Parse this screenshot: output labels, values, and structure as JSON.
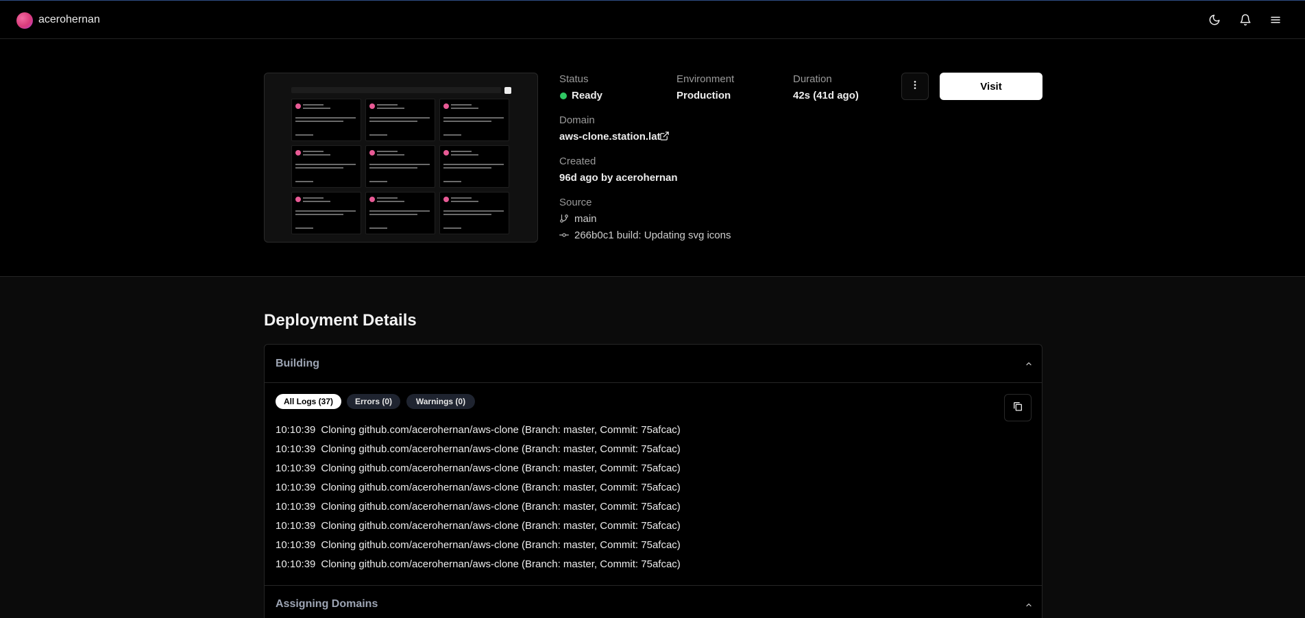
{
  "header": {
    "username": "acerohernan"
  },
  "deployment": {
    "status_label": "Status",
    "status_value": "Ready",
    "environment_label": "Environment",
    "environment_value": "Production",
    "duration_label": "Duration",
    "duration_value": "42s (41d ago)",
    "domain_label": "Domain",
    "domain_value": "aws-clone.station.lat",
    "created_label": "Created",
    "created_value": "96d ago by acerohernan",
    "source_label": "Source",
    "branch": "main",
    "commit": "266b0c1 build: Updating svg icons",
    "visit_label": "Visit"
  },
  "details": {
    "title": "Deployment Details",
    "building_title": "Building",
    "filters": [
      "All Logs (37)",
      "Errors (0)",
      "Warnings (0)"
    ],
    "logs": [
      {
        "time": "10:10:39",
        "msg": "Cloning github.com/acerohernan/aws-clone (Branch: master, Commit: 75afcac)"
      },
      {
        "time": "10:10:39",
        "msg": "Cloning github.com/acerohernan/aws-clone (Branch: master, Commit: 75afcac)"
      },
      {
        "time": "10:10:39",
        "msg": "Cloning github.com/acerohernan/aws-clone (Branch: master, Commit: 75afcac)"
      },
      {
        "time": "10:10:39",
        "msg": "Cloning github.com/acerohernan/aws-clone (Branch: master, Commit: 75afcac)"
      },
      {
        "time": "10:10:39",
        "msg": "Cloning github.com/acerohernan/aws-clone (Branch: master, Commit: 75afcac)"
      },
      {
        "time": "10:10:39",
        "msg": "Cloning github.com/acerohernan/aws-clone (Branch: master, Commit: 75afcac)"
      },
      {
        "time": "10:10:39",
        "msg": "Cloning github.com/acerohernan/aws-clone (Branch: master, Commit: 75afcac)"
      },
      {
        "time": "10:10:39",
        "msg": "Cloning github.com/acerohernan/aws-clone (Branch: master, Commit: 75afcac)"
      }
    ],
    "assigning_title": "Assigning Domains"
  },
  "colors": {
    "accent": "#ffffff",
    "status_ready": "#2fc863",
    "muted": "#9a9a9a"
  },
  "icons": {
    "theme": "moon-icon",
    "notifications": "bell-icon",
    "menu": "hamburger-icon",
    "more": "more-vertical-icon",
    "external": "external-link-icon",
    "branch": "git-branch-icon",
    "commit": "git-commit-icon",
    "copy": "copy-icon",
    "collapse": "chevron-up-icon"
  }
}
